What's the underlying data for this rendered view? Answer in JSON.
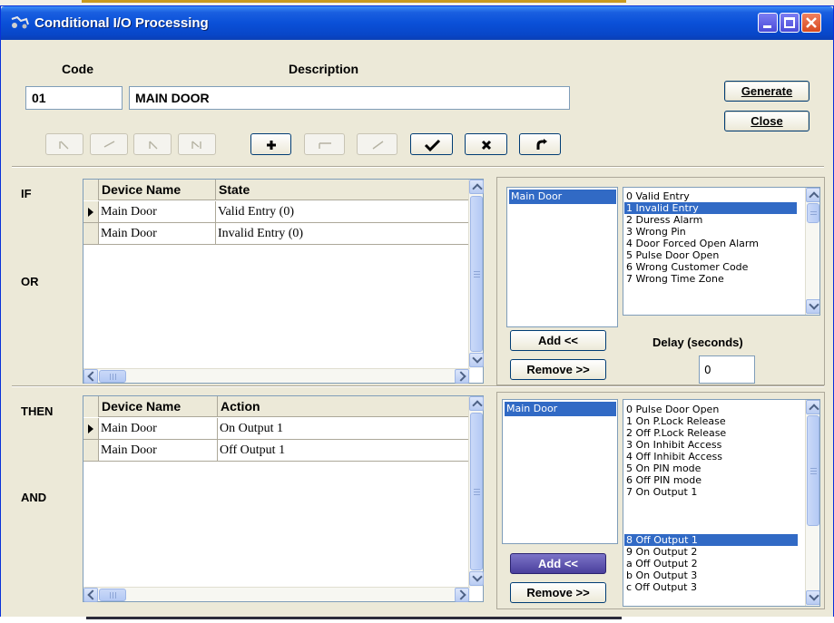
{
  "window": {
    "title": "Conditional I/O Processing"
  },
  "header": {
    "code_label": "Code",
    "description_label": "Description",
    "code_value": "01",
    "description_value": "MAIN DOOR",
    "generate_label": "Generate",
    "close_label": "Close"
  },
  "nav_buttons": [
    {
      "name": "first",
      "enabled": false
    },
    {
      "name": "prior",
      "enabled": false
    },
    {
      "name": "next",
      "enabled": false
    },
    {
      "name": "last",
      "enabled": false
    },
    {
      "name": "insert",
      "enabled": true
    },
    {
      "name": "delete",
      "enabled": false
    },
    {
      "name": "edit",
      "enabled": false
    },
    {
      "name": "post",
      "enabled": true
    },
    {
      "name": "cancel",
      "enabled": true
    },
    {
      "name": "refresh",
      "enabled": true
    }
  ],
  "conditions": {
    "if_label": "IF",
    "or_label": "OR",
    "columns": [
      "Device Name",
      "State"
    ],
    "rows": [
      {
        "device": "Main Door",
        "value": "Valid Entry (0)",
        "current": true
      },
      {
        "device": "Main Door",
        "value": "Invalid Entry (0)",
        "current": false
      }
    ],
    "devices": [
      "Main Door"
    ],
    "states": [
      "0 Valid Entry",
      "1 Invalid Entry",
      "2 Duress Alarm",
      "3 Wrong Pin",
      "4 Door Forced Open Alarm",
      "5 Pulse Door Open",
      "6 Wrong Customer Code",
      "7 Wrong Time Zone"
    ],
    "selected_state": "1 Invalid Entry",
    "add_label": "Add <<",
    "remove_label": "Remove >>",
    "delay_label": "Delay (seconds)",
    "delay_value": "0"
  },
  "actions": {
    "then_label": "THEN",
    "and_label": "AND",
    "columns": [
      "Device Name",
      "Action"
    ],
    "rows": [
      {
        "device": "Main Door",
        "value": "On Output 1",
        "current": true
      },
      {
        "device": "Main Door",
        "value": "Off Output 1",
        "current": false
      }
    ],
    "devices": [
      "Main Door"
    ],
    "actions_list": [
      "0 Pulse Door Open",
      "1 On P.Lock Release",
      "2 Off P.Lock Release",
      "3 On Inhibit Access",
      "4 Off Inhibit Access",
      "5 On PIN mode",
      "6 Off PIN mode",
      "7 On Output 1",
      "8 Off Output 1",
      "9 On Output 2",
      "a Off Output 2",
      "b On Output 3",
      "c Off Output 3"
    ],
    "selected_action": "8 Off Output 1",
    "add_label": "Add <<",
    "remove_label": "Remove >>"
  },
  "colors": {
    "titlebar": "#0a50d8",
    "selection": "#316ac5",
    "window_bg": "#ece9d8"
  }
}
